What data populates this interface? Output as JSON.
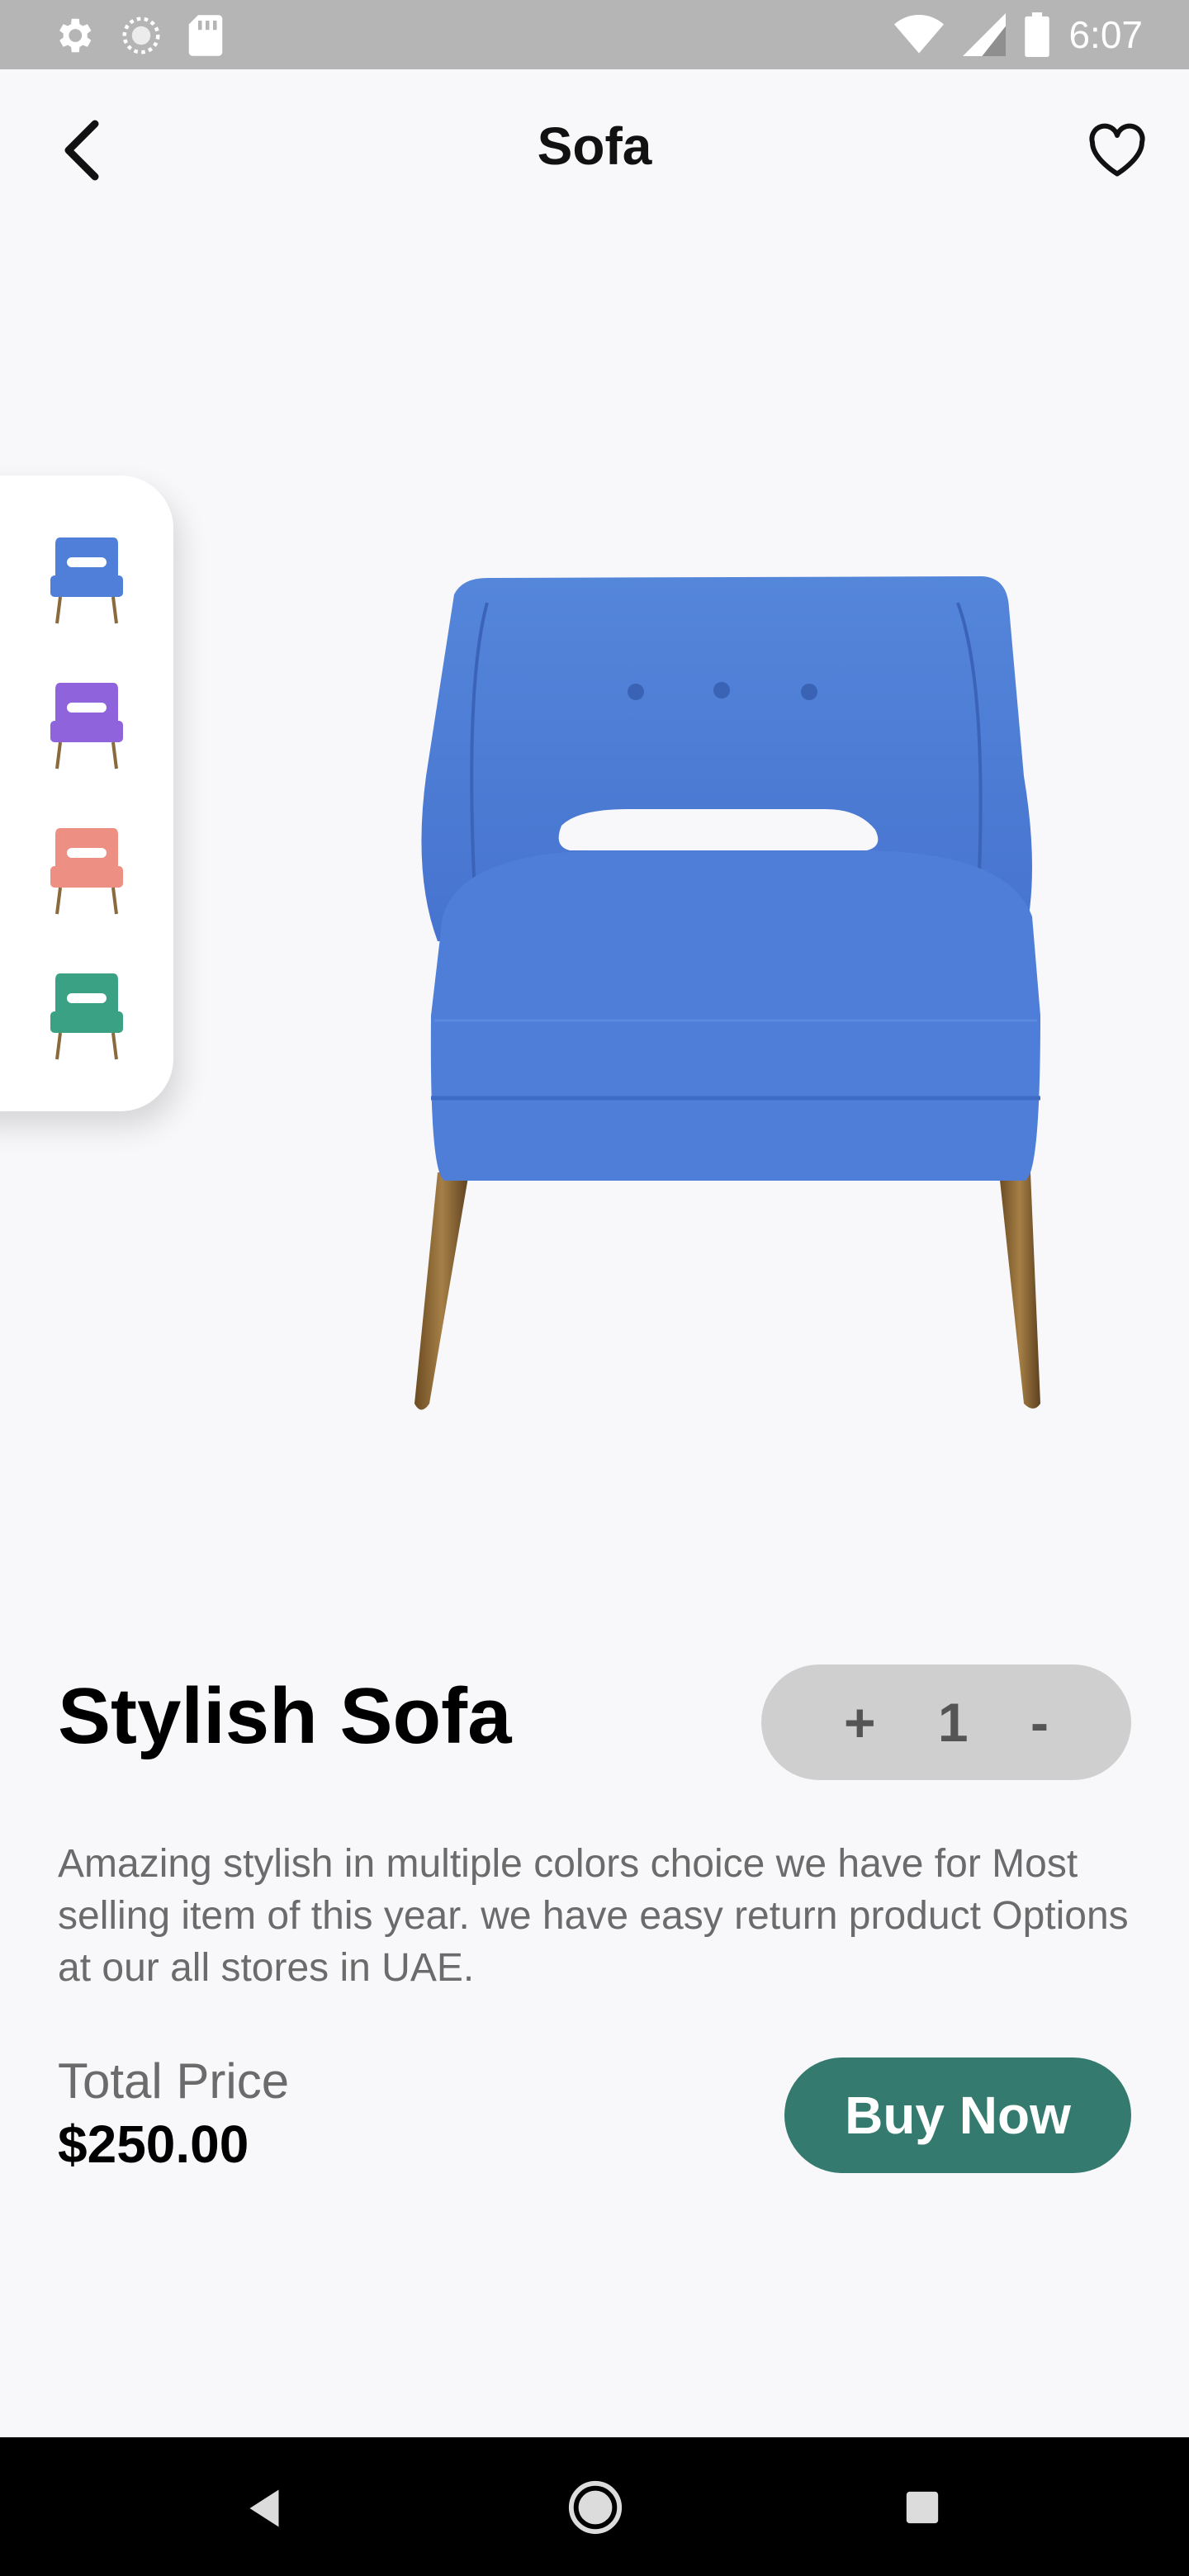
{
  "status_bar": {
    "time": "6:07",
    "icons": [
      "settings-icon",
      "sync-icon",
      "sd-card-icon",
      "wifi-icon",
      "signal-icon",
      "battery-icon"
    ]
  },
  "app_bar": {
    "title": "Sofa",
    "back_icon": "back-arrow-icon",
    "favorite_icon": "heart-outline-icon"
  },
  "thumbnails": [
    {
      "name": "blue-chair",
      "color": "#4f7fd8"
    },
    {
      "name": "purple-chair",
      "color": "#8f63dc"
    },
    {
      "name": "pink-chair",
      "color": "#ee8f84"
    },
    {
      "name": "green-chair",
      "color": "#3aa184"
    }
  ],
  "product": {
    "name": "Stylish Sofa",
    "image_color": "#4f7fd8",
    "description": "Amazing stylish in multiple colors choice we have for Most selling item of this year. we have easy return product Options at our all stores in UAE.",
    "quantity": {
      "plus": "+",
      "value": "1",
      "minus": "-"
    },
    "total_label": "Total Price",
    "total_value": "$250.00",
    "buy_label": "Buy Now"
  },
  "colors": {
    "accent": "#357a6e",
    "background": "#f8f8fa",
    "qty_bg": "#cfcfcf",
    "text_muted": "#6b6b6b"
  },
  "nav_bar": {
    "icons": [
      "nav-back-icon",
      "nav-home-icon",
      "nav-recents-icon"
    ]
  }
}
